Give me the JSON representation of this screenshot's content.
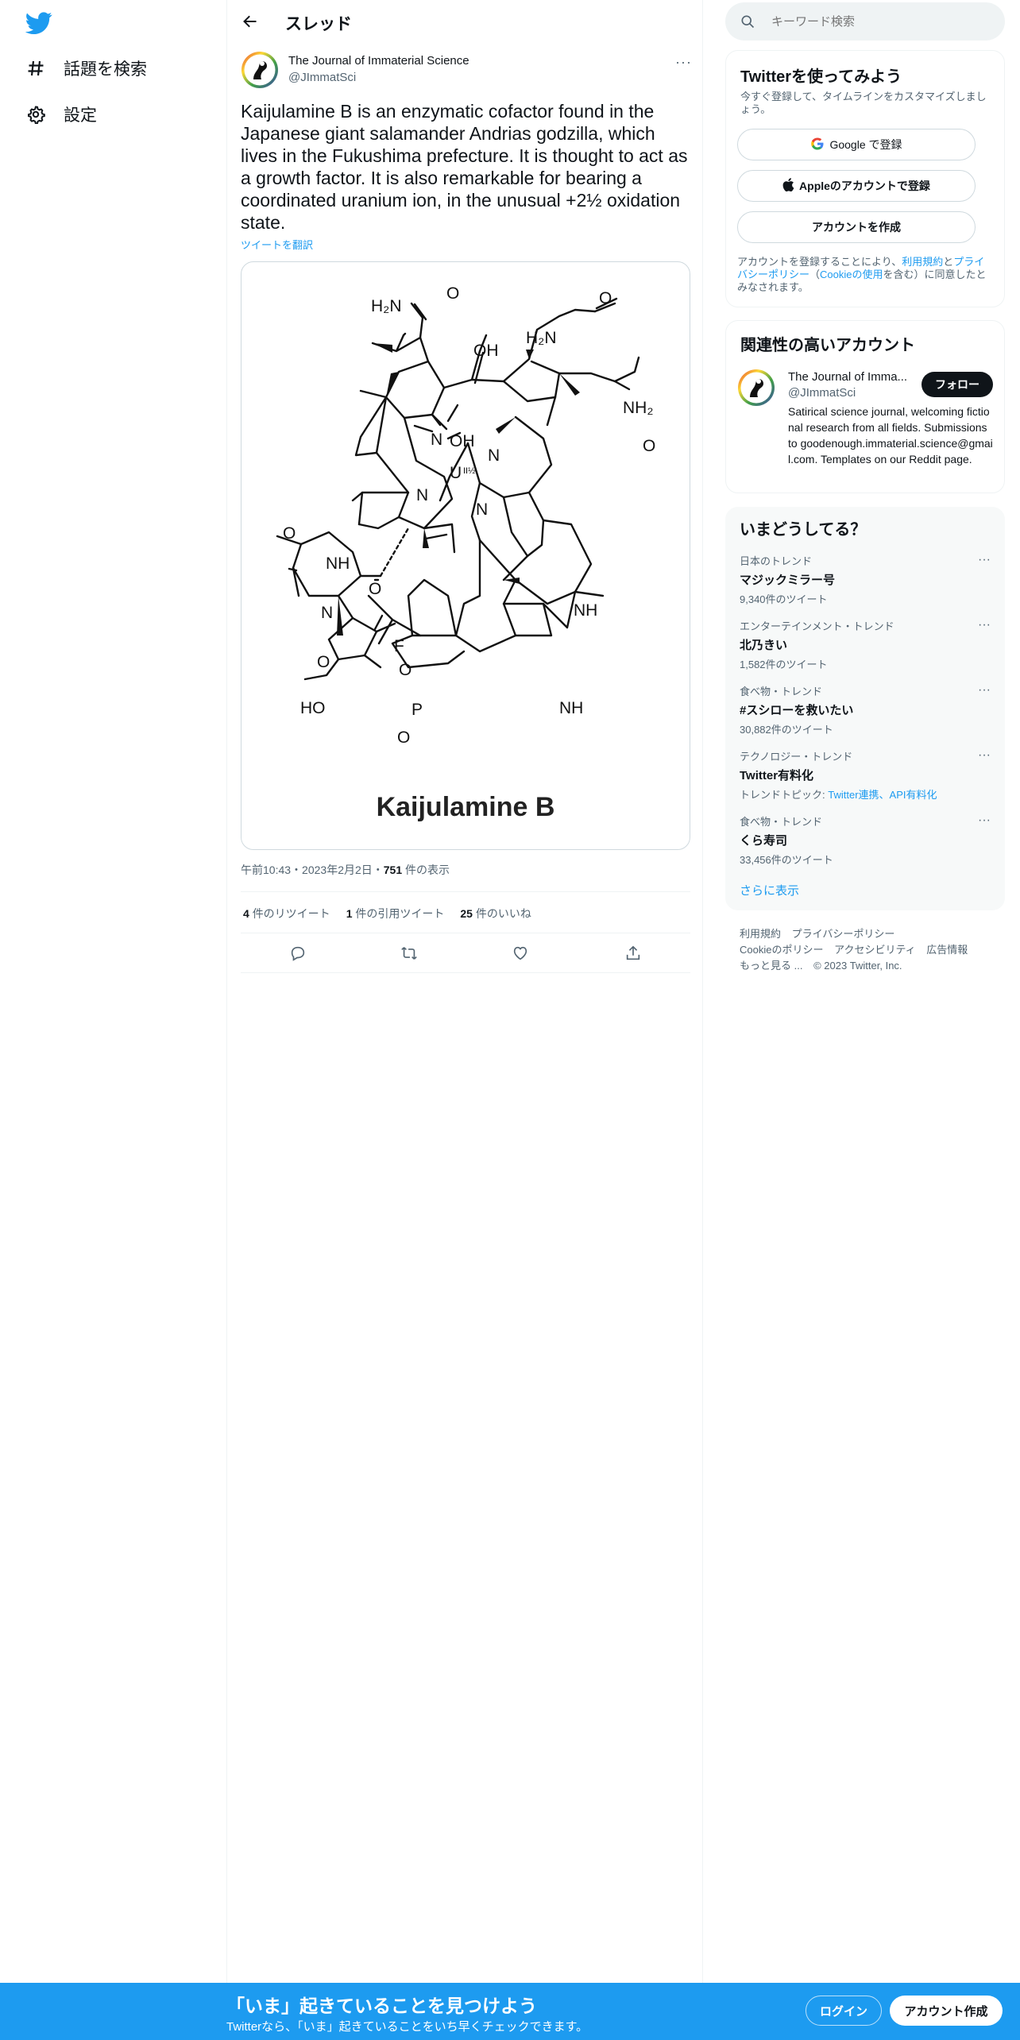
{
  "nav": {
    "explore_label": "話題を検索",
    "settings_label": "設定"
  },
  "thread": {
    "title": "スレッド"
  },
  "tweet": {
    "author_name": "The Journal of Immaterial Science",
    "author_handle": "@JImmatSci",
    "text": "Kaijulamine B is an enzymatic cofactor found in the Japanese giant salamander Andrias godzilla, which lives in the Fukushima prefecture. It is thought to act as a growth factor. It is also remarkable for bearing a coordinated uranium ion, in the unusual +2½ oxidation state.",
    "translate_label": "ツイートを翻訳",
    "image_caption": "Kaijulamine B",
    "time": "午前10:43",
    "date": "2023年2月2日",
    "views_count": "751",
    "views_label": "件の表示",
    "retweets_count": "4",
    "retweets_label": "件のリツイート",
    "quotes_count": "1",
    "quotes_label": "件の引用ツイート",
    "likes_count": "25",
    "likes_label": "件のいいね",
    "dot": "・"
  },
  "molecule_labels": {
    "h2n_1": "H₂N",
    "o_1": "O",
    "oh_1": "OH",
    "h2n_2": "H₂N",
    "o_2": "O",
    "nh2": "NH₂",
    "o_3": "O",
    "oh_2": "OH",
    "n_1": "N",
    "n_2": "N",
    "u": "U",
    "u_ox": "II½",
    "n_3": "N",
    "n_4": "N",
    "o_4": "O",
    "nh_1": "NH",
    "o_5": "O",
    "n_5": "N",
    "f": "F",
    "o_6": "O",
    "o_7": "O",
    "ho": "HO",
    "p": "P",
    "o_8": "O",
    "nh_2": "NH",
    "nh_3": "NH"
  },
  "search": {
    "placeholder": "キーワード検索"
  },
  "signup_card": {
    "title": "Twitterを使ってみよう",
    "subtitle": "今すぐ登録して、タイムラインをカスタマイズしましょう。",
    "google_label": "Google で登録",
    "apple_label": "Appleのアカウントで登録",
    "create_label": "アカウントを作成",
    "legal_1": "アカウントを登録することにより、",
    "legal_terms": "利用規約",
    "legal_2": "と",
    "legal_privacy": "プライバシーポリシー",
    "legal_3": "（",
    "legal_cookie": "Cookieの使用",
    "legal_4": "を含む）に同意したとみなされます。"
  },
  "related_card": {
    "title": "関連性の高いアカウント",
    "name": "The Journal of Imma...",
    "handle": "@JImmatSci",
    "follow_label": "フォロー",
    "bio": "Satirical science journal, welcoming fictional research from all fields. Submissions to goodenough.immaterial.science@gmail.com. Templates on our Reddit page."
  },
  "trends_card": {
    "title": "いまどうしてる？",
    "items": [
      {
        "category": "日本のトレンド",
        "name": "マジックミラー号",
        "count": "9,340件のツイート"
      },
      {
        "category": "エンターテインメント・トレンド",
        "name": "北乃きい",
        "count": "1,582件のツイート"
      },
      {
        "category": "食べ物・トレンド",
        "name": "#スシローを救いたい",
        "count": "30,882件のツイート"
      },
      {
        "category": "テクノロジー・トレンド",
        "name": "Twitter有料化",
        "topic_prefix": "トレンドトピック: ",
        "topics": "Twitter連携、API有料化"
      },
      {
        "category": "食べ物・トレンド",
        "name": "くら寿司",
        "count": "33,456件のツイート"
      }
    ],
    "show_more": "さらに表示"
  },
  "footer": {
    "terms": "利用規約",
    "privacy": "プライバシーポリシー",
    "cookies": "Cookieのポリシー",
    "accessibility": "アクセシビリティ",
    "ads": "広告情報",
    "more": "もっと見る ...",
    "copyright": "© 2023 Twitter, Inc."
  },
  "bottom_bar": {
    "title": "「いま」起きていることを見つけよう",
    "subtitle": "Twitterなら、「いま」起きていることをいち早くチェックできます。",
    "login_label": "ログイン",
    "signup_label": "アカウント作成"
  },
  "colors": {
    "accent": "#1d9bf0",
    "text": "#0f1419",
    "muted": "#536471"
  }
}
